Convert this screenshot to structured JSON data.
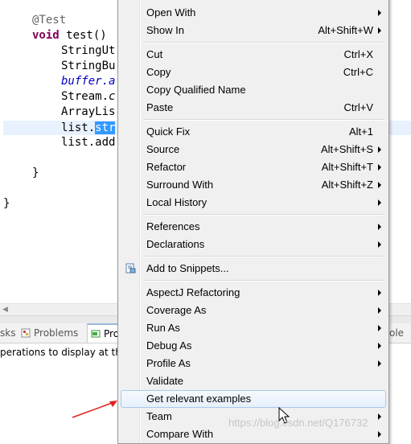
{
  "editor": {
    "lines": [
      {
        "annotation": "@Test"
      },
      {
        "keyword": "void",
        "rest": " test()"
      },
      {
        "text": "StringUt"
      },
      {
        "text": "StringBu"
      },
      {
        "field": "buffer.a"
      },
      {
        "prefix": "Stream.",
        "italic": "c"
      },
      {
        "text": "ArrayLis"
      },
      {
        "prefix": "list.",
        "selected": "str"
      },
      {
        "text": "list.add"
      },
      {
        "text": "}"
      },
      {
        "text": "}"
      }
    ]
  },
  "bottom_panel": {
    "tabs": [
      {
        "label": "sks"
      },
      {
        "label": "Problems"
      },
      {
        "label": "Pro"
      },
      {
        "label": "ole"
      }
    ],
    "message": "perations to display at thi"
  },
  "context_menu": {
    "items": [
      {
        "label": "Open With",
        "shortcut": "",
        "submenu": true
      },
      {
        "label": "Show In",
        "shortcut": "Alt+Shift+W",
        "submenu": true
      },
      {
        "label": "Cut",
        "shortcut": "Ctrl+X",
        "submenu": false
      },
      {
        "label": "Copy",
        "shortcut": "Ctrl+C",
        "submenu": false
      },
      {
        "label": "Copy Qualified Name",
        "shortcut": "",
        "submenu": false
      },
      {
        "label": "Paste",
        "shortcut": "Ctrl+V",
        "submenu": false
      },
      {
        "label": "Quick Fix",
        "shortcut": "Alt+1",
        "submenu": false
      },
      {
        "label": "Source",
        "shortcut": "Alt+Shift+S",
        "submenu": true
      },
      {
        "label": "Refactor",
        "shortcut": "Alt+Shift+T",
        "submenu": true
      },
      {
        "label": "Surround With",
        "shortcut": "Alt+Shift+Z",
        "submenu": true
      },
      {
        "label": "Local History",
        "shortcut": "",
        "submenu": true
      },
      {
        "label": "References",
        "shortcut": "",
        "submenu": true
      },
      {
        "label": "Declarations",
        "shortcut": "",
        "submenu": true
      },
      {
        "label": "Add to Snippets...",
        "shortcut": "",
        "submenu": false,
        "icon": "snippet-icon"
      },
      {
        "label": "AspectJ Refactoring",
        "shortcut": "",
        "submenu": true
      },
      {
        "label": "Coverage As",
        "shortcut": "",
        "submenu": true
      },
      {
        "label": "Run As",
        "shortcut": "",
        "submenu": true
      },
      {
        "label": "Debug As",
        "shortcut": "",
        "submenu": true
      },
      {
        "label": "Profile As",
        "shortcut": "",
        "submenu": true
      },
      {
        "label": "Validate",
        "shortcut": "",
        "submenu": false
      },
      {
        "label": "Get relevant examples",
        "shortcut": "",
        "submenu": false,
        "highlighted": true
      },
      {
        "label": "Team",
        "shortcut": "",
        "submenu": true
      },
      {
        "label": "Compare With",
        "shortcut": "",
        "submenu": true
      }
    ]
  },
  "watermark": "https://blog.csdn.net/Q176732",
  "colors": {
    "keyword": "#7f0055",
    "annotation": "#646464",
    "field": "#0000c0",
    "selection": "#3399ff",
    "current_line": "#e8f2fe",
    "menu_background": "#f0f0f0",
    "menu_hover_border": "#a9c8ec",
    "arrow": "#e02020"
  }
}
